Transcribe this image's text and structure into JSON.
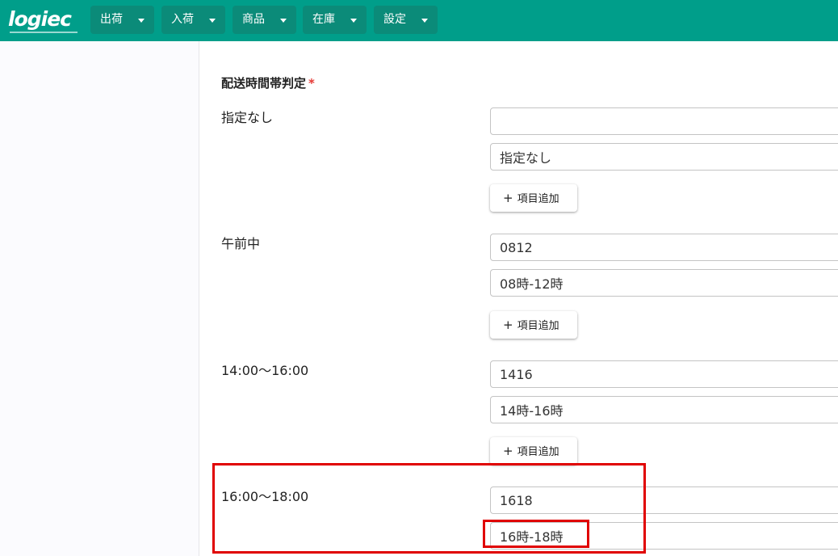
{
  "app": {
    "logo_text": "logiec"
  },
  "nav": [
    {
      "label": "出荷"
    },
    {
      "label": "入荷"
    },
    {
      "label": "商品"
    },
    {
      "label": "在庫"
    },
    {
      "label": "設定"
    }
  ],
  "form": {
    "section_title": "配送時間帯判定",
    "required_mark": "*",
    "add_button_label": "項目追加",
    "rows": [
      {
        "label": "指定なし",
        "code": "",
        "display": "指定なし"
      },
      {
        "label": "午前中",
        "code": "0812",
        "display": "08時-12時"
      },
      {
        "label": "14:00〜16:00",
        "code": "1416",
        "display": "14時-16時"
      },
      {
        "label": "16:00〜18:00",
        "code": "1618",
        "display": "16時-18時"
      }
    ]
  },
  "colors": {
    "header_bg": "#009e8a",
    "menu_bg": "#0b8b79",
    "highlight": "#e00000",
    "required": "#e53935"
  }
}
